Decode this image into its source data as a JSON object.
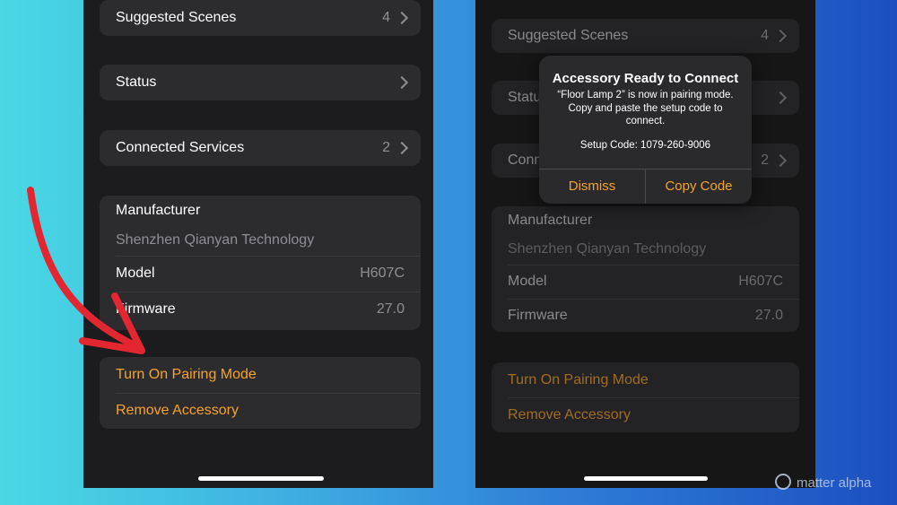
{
  "left_screen": {
    "suggested_scenes": {
      "label": "Suggested Scenes",
      "value": "4"
    },
    "status": {
      "label": "Status"
    },
    "connected_services": {
      "label": "Connected Services",
      "value": "2"
    },
    "manufacturer": {
      "label": "Manufacturer",
      "value": "Shenzhen Qianyan Technology"
    },
    "model": {
      "label": "Model",
      "value": "H607C"
    },
    "firmware": {
      "label": "Firmware",
      "value": "27.0"
    },
    "turn_on_pairing_mode": "Turn On Pairing Mode",
    "remove_accessory": "Remove Accessory"
  },
  "right_screen": {
    "suggested_scenes": {
      "label": "Suggested Scenes",
      "value": "4"
    },
    "status": {
      "label": "Status"
    },
    "connected_services": {
      "label": "Connected Services",
      "value": "2"
    },
    "manufacturer": {
      "label": "Manufacturer",
      "value": "Shenzhen Qianyan Technology"
    },
    "model": {
      "label": "Model",
      "value": "H607C"
    },
    "firmware": {
      "label": "Firmware",
      "value": "27.0"
    },
    "turn_on_pairing_mode": "Turn On Pairing Mode",
    "remove_accessory": "Remove Accessory",
    "alert": {
      "title": "Accessory Ready to Connect",
      "message": "“Floor Lamp 2” is now in pairing mode. Copy and paste the setup code to connect.",
      "setup_code": "Setup Code: 1079-260-9006",
      "dismiss_label": "Dismiss",
      "copy_label": "Copy Code"
    }
  },
  "watermark": "matter alpha",
  "colors": {
    "accent": "#f6a32a",
    "annotation_arrow": "#e3262f"
  }
}
